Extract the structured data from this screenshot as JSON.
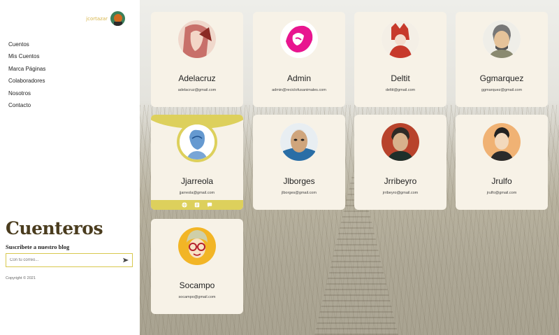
{
  "user": {
    "name": "jcortazar"
  },
  "menu": [
    "Cuentos",
    "Mis Cuentos",
    "Marca Páginas",
    "Colaboradores",
    "Nosotros",
    "Contacto"
  ],
  "brand": "Cuenteros",
  "newsletter": {
    "title": "Suscribete a nuestro blog",
    "placeholder": "Con tu correo..."
  },
  "copyright": "Copyright © 2021",
  "colors": {
    "accent": "#ddd05c",
    "card": "#f7f2e7",
    "brand": "#4a3c1e"
  },
  "authors": [
    {
      "name": "Adelacruz",
      "email": "adelacruz@gmail.com"
    },
    {
      "name": "Admin",
      "email": "admin@reciclofusanimales.com"
    },
    {
      "name": "Deltit",
      "email": "deltit@gmail.com"
    },
    {
      "name": "Ggmarquez",
      "email": "ggmarquez@gmail.com"
    },
    {
      "name": "Jjarreola",
      "email": "jjarreola@gmail.com"
    },
    {
      "name": "Jlborges",
      "email": "jlborges@gmail.com"
    },
    {
      "name": "Jrribeyro",
      "email": "jrribeyro@gmail.com"
    },
    {
      "name": "Jrulfo",
      "email": "jrulfo@gmail.com"
    },
    {
      "name": "Socampo",
      "email": "socampo@gmail.com"
    }
  ],
  "card_actions": [
    "globe-icon",
    "book-icon",
    "comment-icon"
  ]
}
